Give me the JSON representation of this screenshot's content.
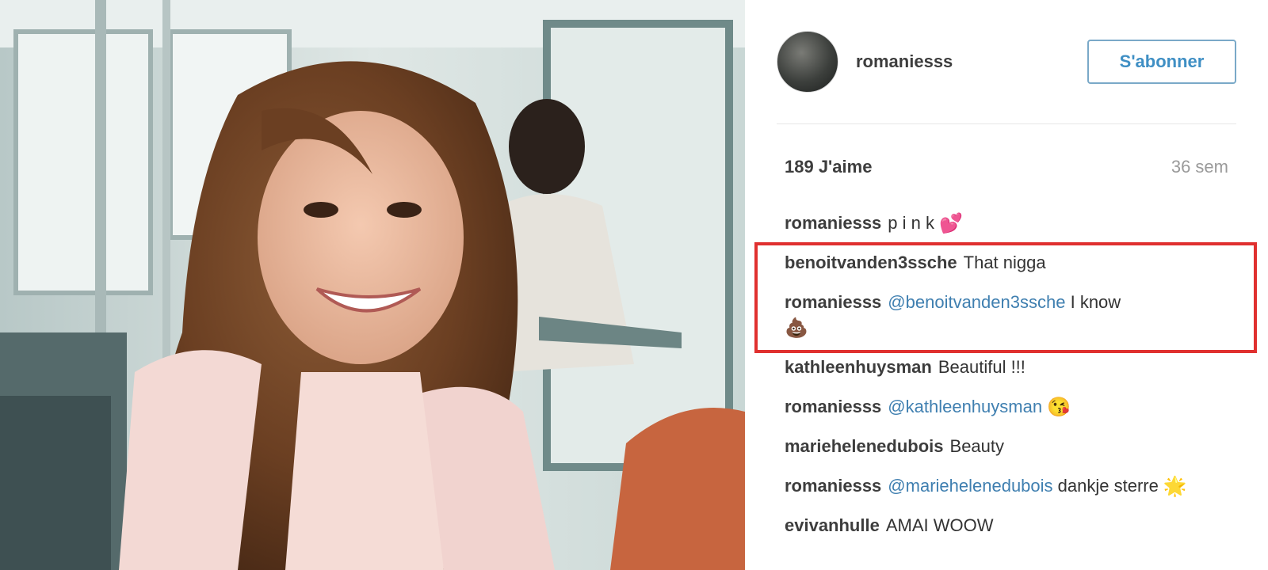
{
  "post": {
    "username": "romaniesss",
    "follow_label": "S'abonner",
    "likes": "189 J'aime",
    "time": "36 sem"
  },
  "comments": [
    {
      "user": "romaniesss",
      "text": "p i n k",
      "emoji": "💕"
    },
    {
      "user": "benoitvanden3ssche",
      "text": "That nigga"
    },
    {
      "user": "romaniesss",
      "mention": "@benoitvanden3ssche",
      "text": "I know",
      "emoji": "💩"
    },
    {
      "user": "kathleenhuysman",
      "text": "Beautiful !!!"
    },
    {
      "user": "romaniesss",
      "mention": "@kathleenhuysman",
      "text": "",
      "emoji": "😘"
    },
    {
      "user": "mariehelenedubois",
      "text": "Beauty"
    },
    {
      "user": "romaniesss",
      "mention": "@mariehelenedubois",
      "text": "dankje sterre",
      "emoji": "🌟"
    },
    {
      "user": "evivanhulle",
      "text": "AMAI WOOW"
    }
  ],
  "colors": {
    "highlight": "#e0302f",
    "link": "#3f7fb0",
    "follow": "#3f8fc4"
  }
}
